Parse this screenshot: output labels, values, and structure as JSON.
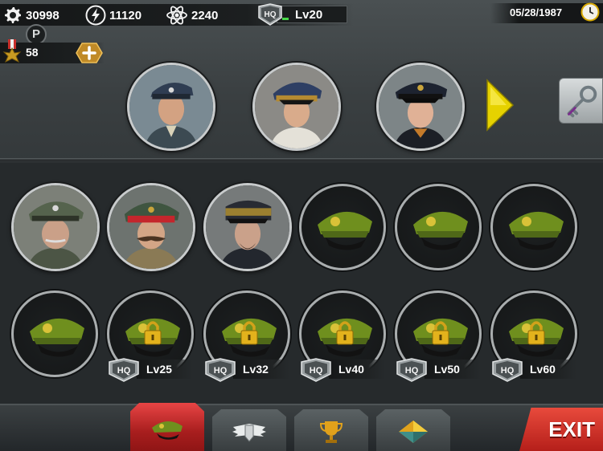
{
  "resources": {
    "gold": "30998",
    "energy": "11120",
    "science": "2240",
    "medals": "58"
  },
  "hq": {
    "badge": "HQ",
    "level": "Lv20"
  },
  "date": "05/28/1987",
  "p_badge": "P",
  "locked_slots": [
    {
      "badge": "HQ",
      "level": "Lv25"
    },
    {
      "badge": "HQ",
      "level": "Lv32"
    },
    {
      "badge": "HQ",
      "level": "Lv40"
    },
    {
      "badge": "HQ",
      "level": "Lv50"
    },
    {
      "badge": "HQ",
      "level": "Lv60"
    }
  ],
  "exit_label": "EXIT",
  "colors": {
    "accent_red": "#d3302a",
    "arrow_yellow": "#e6d200",
    "cap_green": "#6f8f1e",
    "lock_gold": "#e3b21c"
  }
}
